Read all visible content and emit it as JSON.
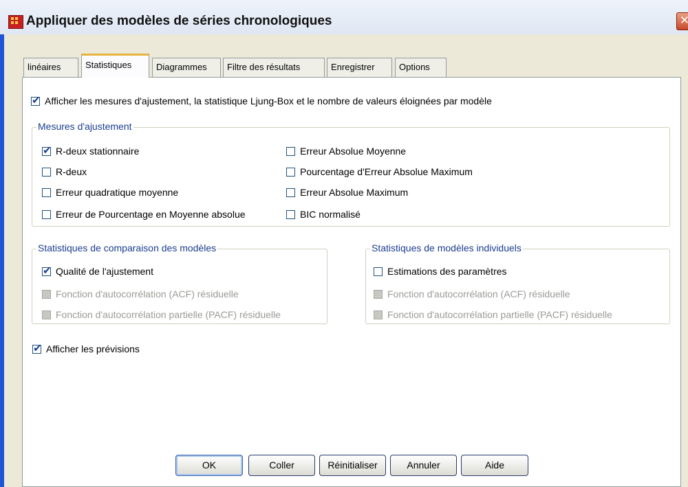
{
  "window": {
    "title": "Appliquer des modèles de séries chronologiques"
  },
  "tabs": [
    {
      "label": "linéaires"
    },
    {
      "label": "Statistiques"
    },
    {
      "label": "Diagrammes"
    },
    {
      "label": "Filtre des résultats"
    },
    {
      "label": "Enregistrer"
    },
    {
      "label": "Options"
    }
  ],
  "main": {
    "display_fit": {
      "label": "Afficher les mesures d'ajustement, la statistique Ljung-Box et le nombre de valeurs éloignées par modèle",
      "checked": true
    },
    "fit_measures": {
      "title": "Mesures d'ajustement",
      "items": [
        {
          "label": "R-deux stationnaire",
          "checked": true
        },
        {
          "label": "R-deux",
          "checked": false
        },
        {
          "label": "Erreur quadratique moyenne",
          "checked": false
        },
        {
          "label": "Erreur de Pourcentage en Moyenne absolue",
          "checked": false
        },
        {
          "label": "Erreur Absolue Moyenne",
          "checked": false
        },
        {
          "label": "Pourcentage d'Erreur Absolue Maximum",
          "checked": false
        },
        {
          "label": "Erreur Absolue Maximum",
          "checked": false
        },
        {
          "label": "BIC normalisé",
          "checked": false
        }
      ]
    },
    "comparison": {
      "title": "Statistiques de comparaison des modèles",
      "items": [
        {
          "label": "Qualité de l'ajustement",
          "checked": true,
          "enabled": true
        },
        {
          "label": "Fonction d'autocorrélation (ACF) résiduelle",
          "checked": false,
          "enabled": false
        },
        {
          "label": "Fonction d'autocorrélation partielle (PACF) résiduelle",
          "checked": false,
          "enabled": false
        }
      ]
    },
    "individual": {
      "title": "Statistiques de modèles individuels",
      "items": [
        {
          "label": "Estimations des paramètres",
          "checked": false,
          "enabled": true
        },
        {
          "label": "Fonction d'autocorrélation (ACF) résiduelle",
          "checked": false,
          "enabled": false
        },
        {
          "label": "Fonction d'autocorrélation partielle (PACF) résiduelle",
          "checked": false,
          "enabled": false
        }
      ]
    },
    "forecasts": {
      "label": "Afficher les prévisions",
      "checked": true
    }
  },
  "buttons": {
    "ok": "OK",
    "paste": "Coller",
    "reset": "Réinitialiser",
    "cancel": "Annuler",
    "help": "Aide"
  }
}
